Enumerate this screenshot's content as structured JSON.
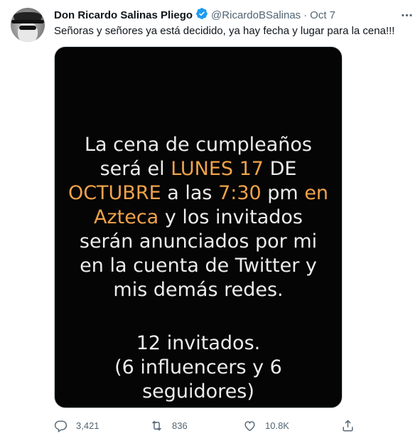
{
  "tweet": {
    "author_name": "Don Ricardo Salinas Pliego",
    "handle": "@RicardoBSalinas",
    "separator": "·",
    "date": "Oct 7",
    "text": "Señoras y señores ya está decidido, ya hay fecha y lugar para la cena!!!"
  },
  "image_text": {
    "line1": "La cena de cumpleaños",
    "line2_a": "será el ",
    "line2_b": "LUNES 17",
    "line2_c": " DE",
    "line3_a": "OCTUBRE",
    "line3_b": " a las ",
    "line3_c": "7:30",
    "line3_d": " pm ",
    "line3_e": "en",
    "line4_a": "Azteca",
    "line4_b": " y los invitados",
    "line5": "serán anunciados por mi",
    "line6": "en la cuenta de Twitter y",
    "line7": "mis demás redes.",
    "line8": "12 invitados.",
    "line9": "(6 influencers y 6",
    "line10": "seguidores)"
  },
  "actions": {
    "replies": "3,421",
    "retweets": "836",
    "likes": "10.8K"
  },
  "colors": {
    "highlight": "#f0a24a",
    "verified": "#1d9bf0",
    "secondary_text": "#536471"
  },
  "icons": [
    "more-icon",
    "verified-badge-icon",
    "reply-icon",
    "retweet-icon",
    "like-icon",
    "share-icon"
  ]
}
